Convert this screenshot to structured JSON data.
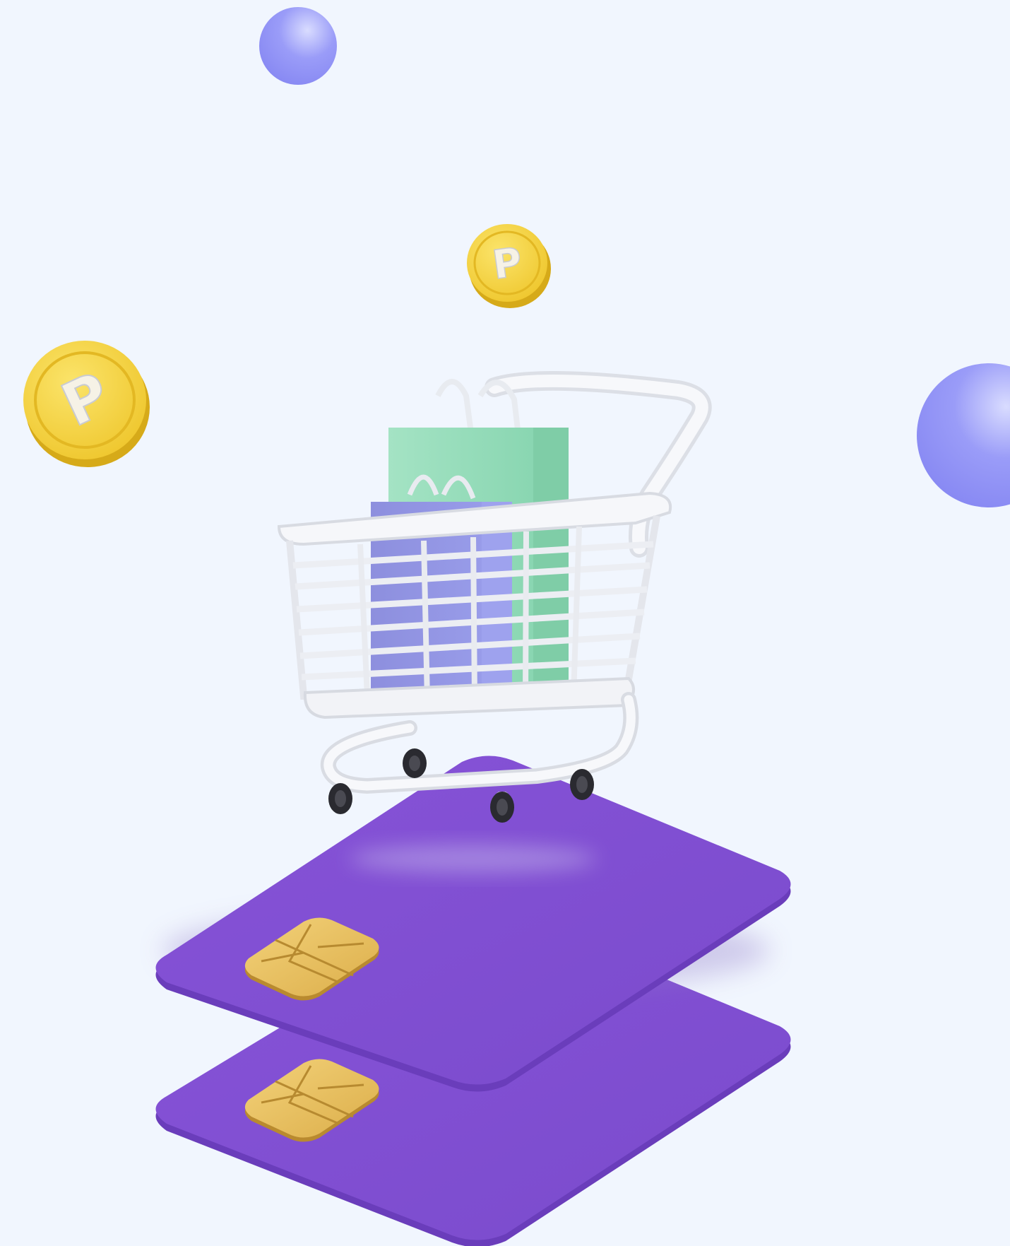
{
  "scene": {
    "background": "#f1f6fe",
    "colors": {
      "card": "#7e4fd0",
      "card_edge": "#6b3fbf",
      "chip": "#e7bd57",
      "coin": "#f0cf3c",
      "coin_edge": "#d9ad1c",
      "orb": "#8b8cf6",
      "bag_green": "#92dcb8",
      "bag_purple": "#8a8ee0",
      "cart_metal": "#f4f5f8"
    },
    "coins": [
      {
        "letter": "P",
        "icon": "coin-icon"
      },
      {
        "letter": "P",
        "icon": "coin-icon"
      }
    ],
    "items": [
      "shopping-cart-icon",
      "shopping-bag-icon",
      "shopping-bag-icon",
      "credit-card-icon",
      "credit-card-icon",
      "chip-icon",
      "orb-icon"
    ]
  }
}
